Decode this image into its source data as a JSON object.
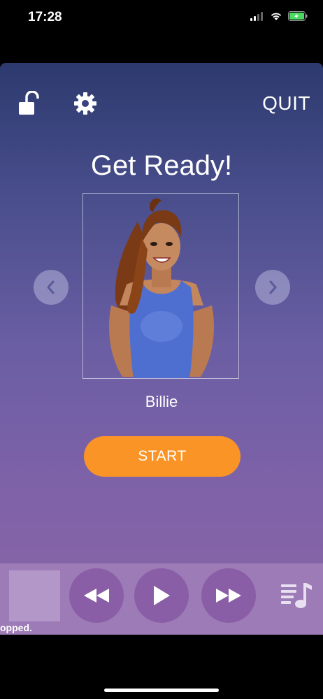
{
  "status_bar": {
    "time": "17:28",
    "icons": [
      "signal-icon",
      "wifi-icon",
      "battery-charging-icon"
    ],
    "battery_color": "#4cd964"
  },
  "top_bar": {
    "lock_icon": "unlock-icon",
    "settings_icon": "gear-icon",
    "quit_label": "QUIT"
  },
  "main": {
    "title": "Get Ready!",
    "character_name": "Billie",
    "prev_icon": "chevron-left-icon",
    "next_icon": "chevron-right-icon",
    "start_label": "START"
  },
  "player": {
    "status_text": "opped.",
    "controls": [
      "rewind-icon",
      "play-icon",
      "fast-forward-icon",
      "playlist-icon"
    ]
  },
  "colors": {
    "accent": "#fb9426",
    "gradient_top": "#2c3a6e",
    "gradient_bottom": "#8a64a6",
    "player_bg": "#9c7bb6",
    "control_bg": "#8a5ea6"
  }
}
